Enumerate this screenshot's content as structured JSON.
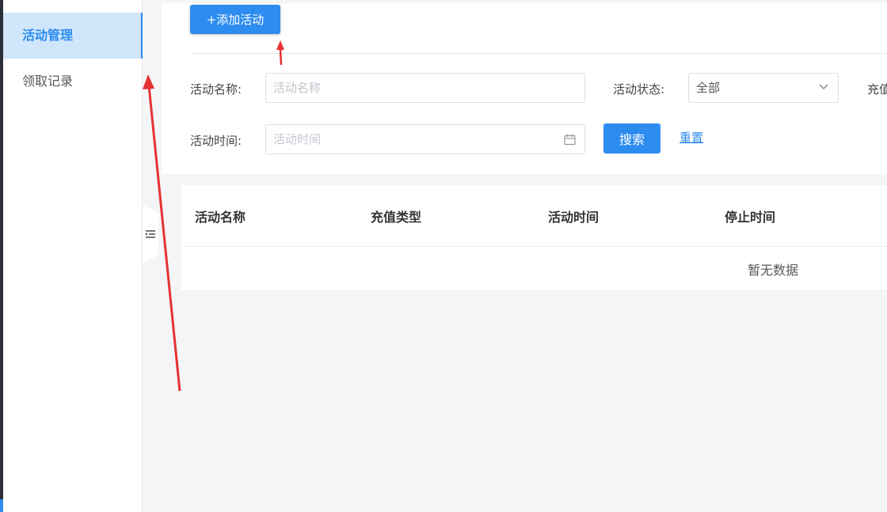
{
  "sidebar": {
    "items": [
      {
        "label": "活动管理",
        "active": true
      },
      {
        "label": "领取记录",
        "active": false
      }
    ]
  },
  "toolbar": {
    "add_label": "+添加活动"
  },
  "filters": {
    "name_label": "活动名称:",
    "name_placeholder": "活动名称",
    "status_label": "活动状态:",
    "status_value": "全部",
    "recharge_label_partial": "充值",
    "time_label": "活动时间:",
    "time_placeholder": "活动时间",
    "search_label": "搜索",
    "reset_label": "重置"
  },
  "table": {
    "columns": [
      "活动名称",
      "充值类型",
      "活动时间",
      "停止时间"
    ],
    "empty_text": "暂无数据"
  },
  "colors": {
    "primary": "#2d8cf0",
    "sidebar_active_bg": "#cfe6fb",
    "annotation_red": "#e63232"
  },
  "icons": [
    "chevron-down-icon",
    "calendar-icon",
    "menu-collapse-icon"
  ]
}
